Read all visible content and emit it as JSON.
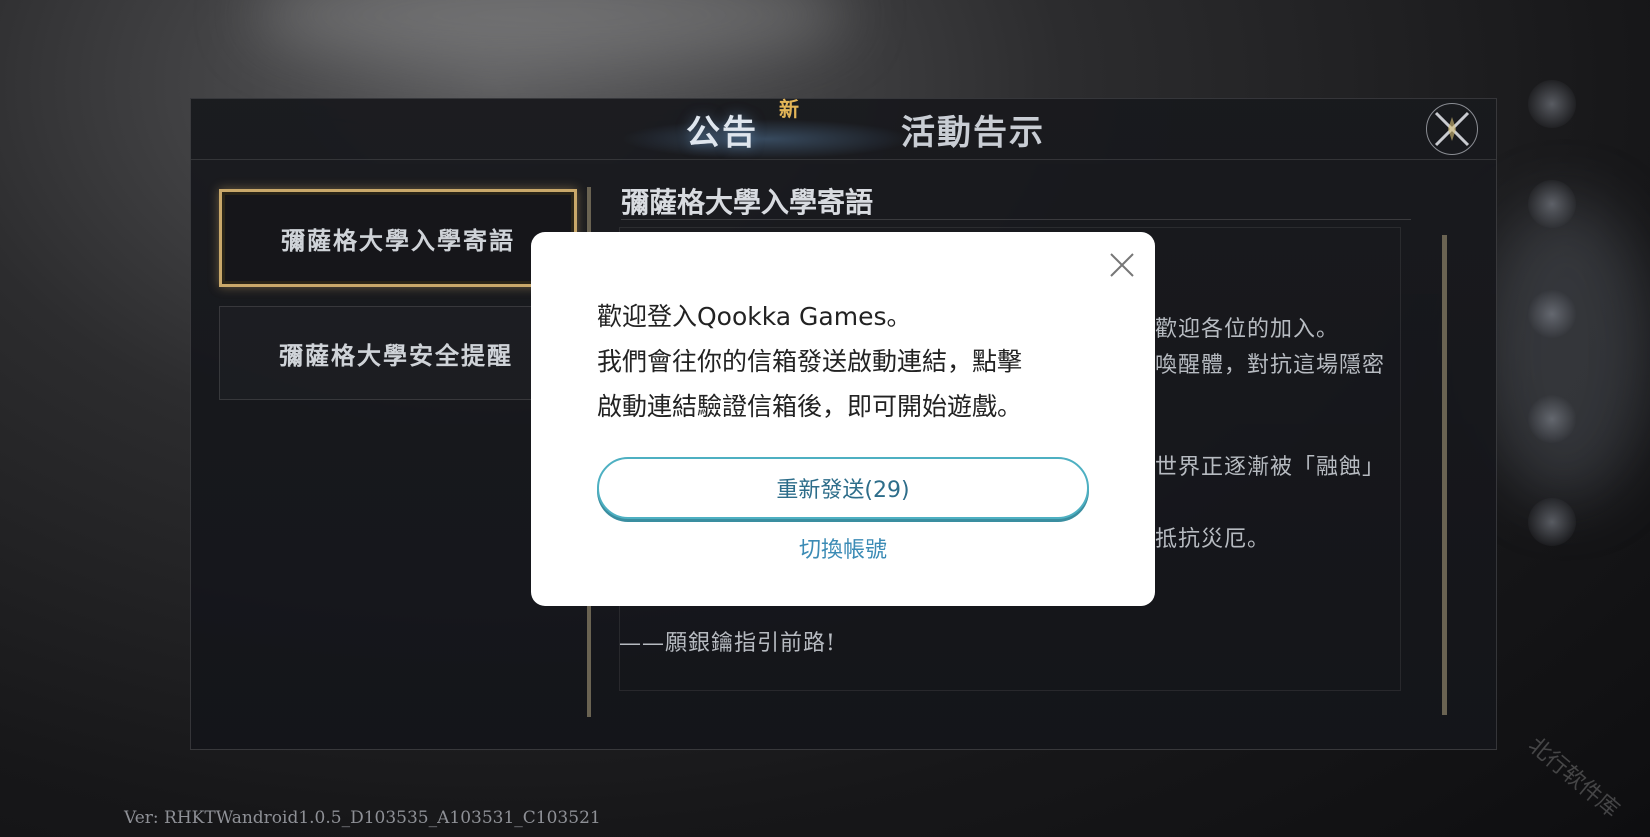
{
  "tabs": {
    "announcement": "公告",
    "new_badge": "新",
    "event": "活動告示"
  },
  "sidebar": {
    "items": [
      {
        "label": "彌薩格大學入學寄語"
      },
      {
        "label": "彌薩格大學安全提醒"
      }
    ]
  },
  "content": {
    "title": "彌薩格大學入學寄語",
    "fragments": [
      "歡迎各位的加入。",
      "喚醒體，對抗這場隱密",
      "世界正逐漸被「融蝕」",
      "抵抗災厄。",
      "——願銀鑰指引前路!"
    ]
  },
  "modal": {
    "message_lines": [
      "歡迎登入Qookka Games。",
      "我們會往你的信箱發送啟動連結，點擊",
      "啟動連結驗證信箱後，即可開始遊戲。"
    ],
    "resend_label": "重新發送(29)",
    "switch_account_label": "切換帳號"
  },
  "footer": {
    "version": "Ver: RHKTWandroid1.0.5_D103535_A103531_C103521",
    "watermark": "北行软件库"
  },
  "colors": {
    "accent_gold": "#c9a86a",
    "badge_gold": "#e3b557",
    "button_teal": "#4eb0c2",
    "link_blue": "#3b8bb5"
  },
  "icons": {
    "panel_close": "compass-close-icon",
    "modal_close": "close-icon"
  }
}
